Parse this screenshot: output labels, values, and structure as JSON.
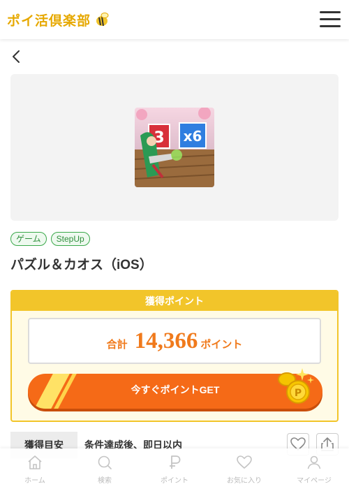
{
  "header": {
    "logo_text": "ポイ活倶楽部",
    "logo_mark_icon": "bee-icon",
    "menu_icon": "hamburger-menu-icon"
  },
  "nav": {
    "back_icon": "chevron-left-icon"
  },
  "offer": {
    "app_icon": "game-app-icon",
    "tags": [
      "ゲーム",
      "StepUp"
    ],
    "title": "パズル＆カオス（iOS）"
  },
  "points": {
    "header": "獲得ポイント",
    "total_label": "合計",
    "total_value": "14,366",
    "total_unit": "ポイント",
    "get_button": "今すぐポイントGET",
    "coin_icon": "coin-sparkle-icon"
  },
  "estimate": {
    "label": "獲得目安",
    "value": "条件達成後、即日以内",
    "favorite_icon": "heart-icon",
    "share_icon": "share-icon"
  },
  "bottom_nav": {
    "items": [
      {
        "label": "ホーム",
        "icon": "home-icon"
      },
      {
        "label": "検索",
        "icon": "search-icon"
      },
      {
        "label": "ポイント",
        "icon": "point-icon"
      },
      {
        "label": "お気に入り",
        "icon": "heart-icon"
      },
      {
        "label": "マイページ",
        "icon": "user-icon"
      }
    ]
  },
  "colors": {
    "brand_yellow": "#f2c52a",
    "accent_orange": "#f56a17",
    "tag_green": "#3aa84a"
  }
}
